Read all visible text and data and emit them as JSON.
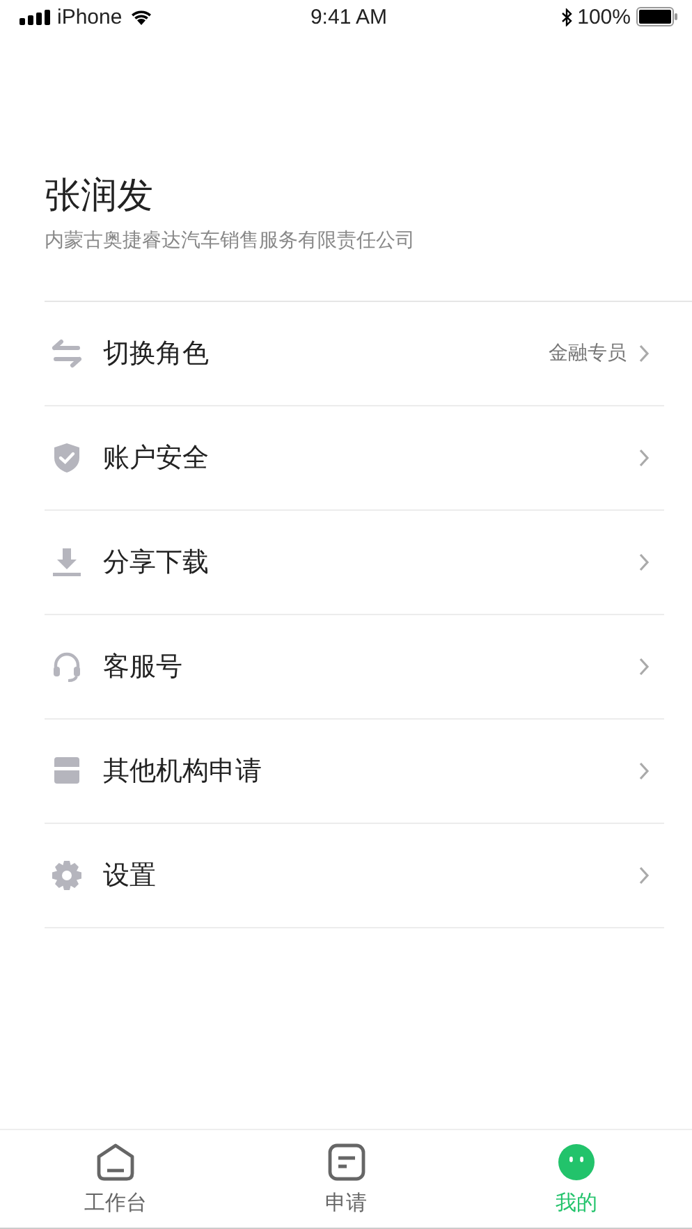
{
  "status_bar": {
    "carrier": "iPhone",
    "time": "9:41 AM",
    "battery": "100%"
  },
  "profile": {
    "name": "张润发",
    "company": "内蒙古奥捷睿达汽车销售服务有限责任公司"
  },
  "menu": [
    {
      "kind": "swap",
      "label": "切换角色",
      "value": "金融专员"
    },
    {
      "kind": "shield",
      "label": "账户安全"
    },
    {
      "kind": "download",
      "label": "分享下载"
    },
    {
      "kind": "headset",
      "label": "客服号"
    },
    {
      "kind": "store",
      "label": "其他机构申请"
    },
    {
      "kind": "gear",
      "label": "设置"
    }
  ],
  "tab_bar": [
    {
      "kind": "home",
      "label": "工作台",
      "selected": false
    },
    {
      "kind": "doc",
      "label": "申请",
      "selected": false
    },
    {
      "kind": "face",
      "label": "我的",
      "selected": true
    }
  ]
}
